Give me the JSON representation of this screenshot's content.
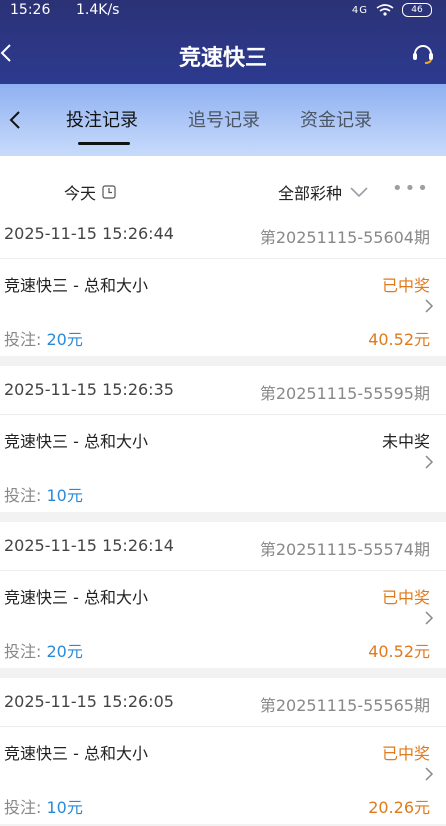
{
  "status": {
    "time": "15:26",
    "speed": "1.4K/s",
    "network": "4G",
    "battery": "46"
  },
  "header": {
    "title": "竞速快三"
  },
  "tabs": [
    {
      "label": "投注记录",
      "active": true
    },
    {
      "label": "追号记录",
      "active": false
    },
    {
      "label": "资金记录",
      "active": false
    }
  ],
  "filter": {
    "date": "今天",
    "game": "全部彩种",
    "more": "•••"
  },
  "records": [
    {
      "time": "2025-11-15 15:26:44",
      "issue": "第20251115-55604期",
      "game": "竞速快三 - 总和大小",
      "status": "已中奖",
      "bet_label": "投注:",
      "bet_amount": "20元",
      "win": "40.52元"
    },
    {
      "time": "2025-11-15 15:26:35",
      "issue": "第20251115-55595期",
      "game": "竞速快三 - 总和大小",
      "status": "未中奖",
      "bet_label": "投注:",
      "bet_amount": "10元",
      "win": ""
    },
    {
      "time": "2025-11-15 15:26:14",
      "issue": "第20251115-55574期",
      "game": "竞速快三 - 总和大小",
      "status": "已中奖",
      "bet_label": "投注:",
      "bet_amount": "20元",
      "win": "40.52元"
    },
    {
      "time": "2025-11-15 15:26:05",
      "issue": "第20251115-55565期",
      "game": "竞速快三 - 总和大小",
      "status": "已中奖",
      "bet_label": "投注:",
      "bet_amount": "10元",
      "win": "20.26元"
    }
  ]
}
